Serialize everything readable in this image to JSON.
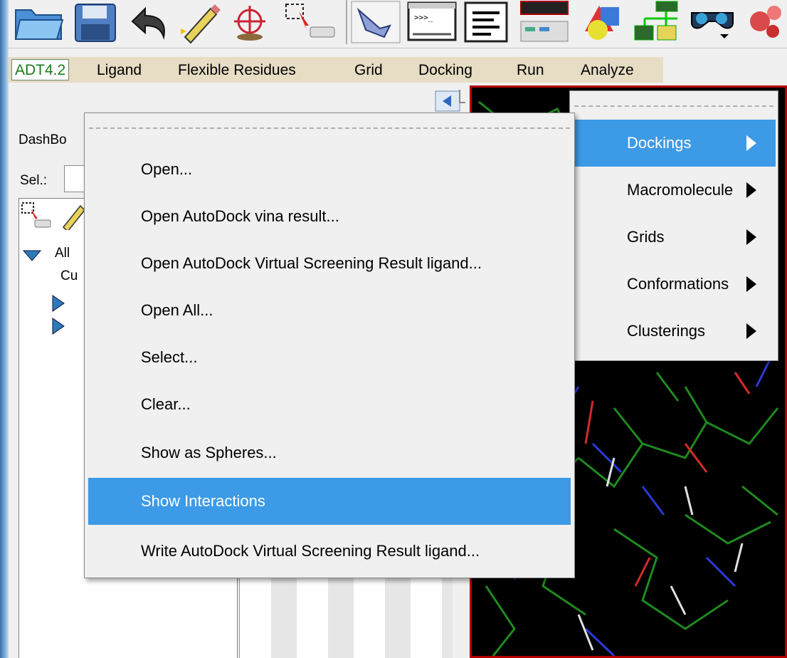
{
  "toolbar": {
    "buttons": [
      {
        "icon": "open-folder-icon"
      },
      {
        "icon": "save-disk-icon"
      },
      {
        "icon": "undo-icon"
      },
      {
        "icon": "pencil-select-icon"
      },
      {
        "icon": "crosshair-center-icon"
      },
      {
        "icon": "clear-selection-icon"
      },
      {
        "icon": "pointer-hand-icon"
      },
      {
        "icon": "python-shell-icon"
      },
      {
        "icon": "text-lines-icon"
      },
      {
        "icon": "dashboard-icon"
      },
      {
        "icon": "3d-shapes-icon"
      },
      {
        "icon": "tree-graph-icon"
      },
      {
        "icon": "stereo-glasses-icon"
      },
      {
        "icon": "molecule-icon"
      }
    ]
  },
  "menubar": {
    "items": [
      "ADT4.2",
      "Ligand",
      "Flexible Residues",
      "Grid",
      "Docking",
      "Run",
      "Analyze"
    ]
  },
  "dashboard": {
    "title_visible": "DashBo",
    "sel_label": "Sel.:",
    "sel_value": "",
    "tree": {
      "root_visible": "All",
      "child_visible": "Cu"
    }
  },
  "analyze_menu": {
    "items": [
      {
        "label": "Dockings",
        "active": true
      },
      {
        "label": "Macromolecule",
        "active": false
      },
      {
        "label": "Grids",
        "active": false
      },
      {
        "label": "Conformations",
        "active": false
      },
      {
        "label": "Clusterings",
        "active": false
      }
    ]
  },
  "dockings_submenu": {
    "items": [
      {
        "label": "Open...",
        "active": false
      },
      {
        "label": "Open AutoDock vina result...",
        "active": false
      },
      {
        "label": "Open AutoDock Virtual Screening Result ligand...",
        "active": false
      },
      {
        "label": "Open All...",
        "active": false
      },
      {
        "label": "Select...",
        "active": false
      },
      {
        "label": "Clear...",
        "active": false
      },
      {
        "label": "Show as Spheres...",
        "active": false
      },
      {
        "label": "Show Interactions",
        "active": true
      },
      {
        "label": "Write AutoDock Virtual Screening Result ligand...",
        "active": false
      }
    ]
  },
  "colors": {
    "menubar_bg": "#e7dcc4",
    "highlight": "#3c9ae6",
    "viewer_border": "#b80000",
    "adt_text": "#1a7a1a"
  }
}
